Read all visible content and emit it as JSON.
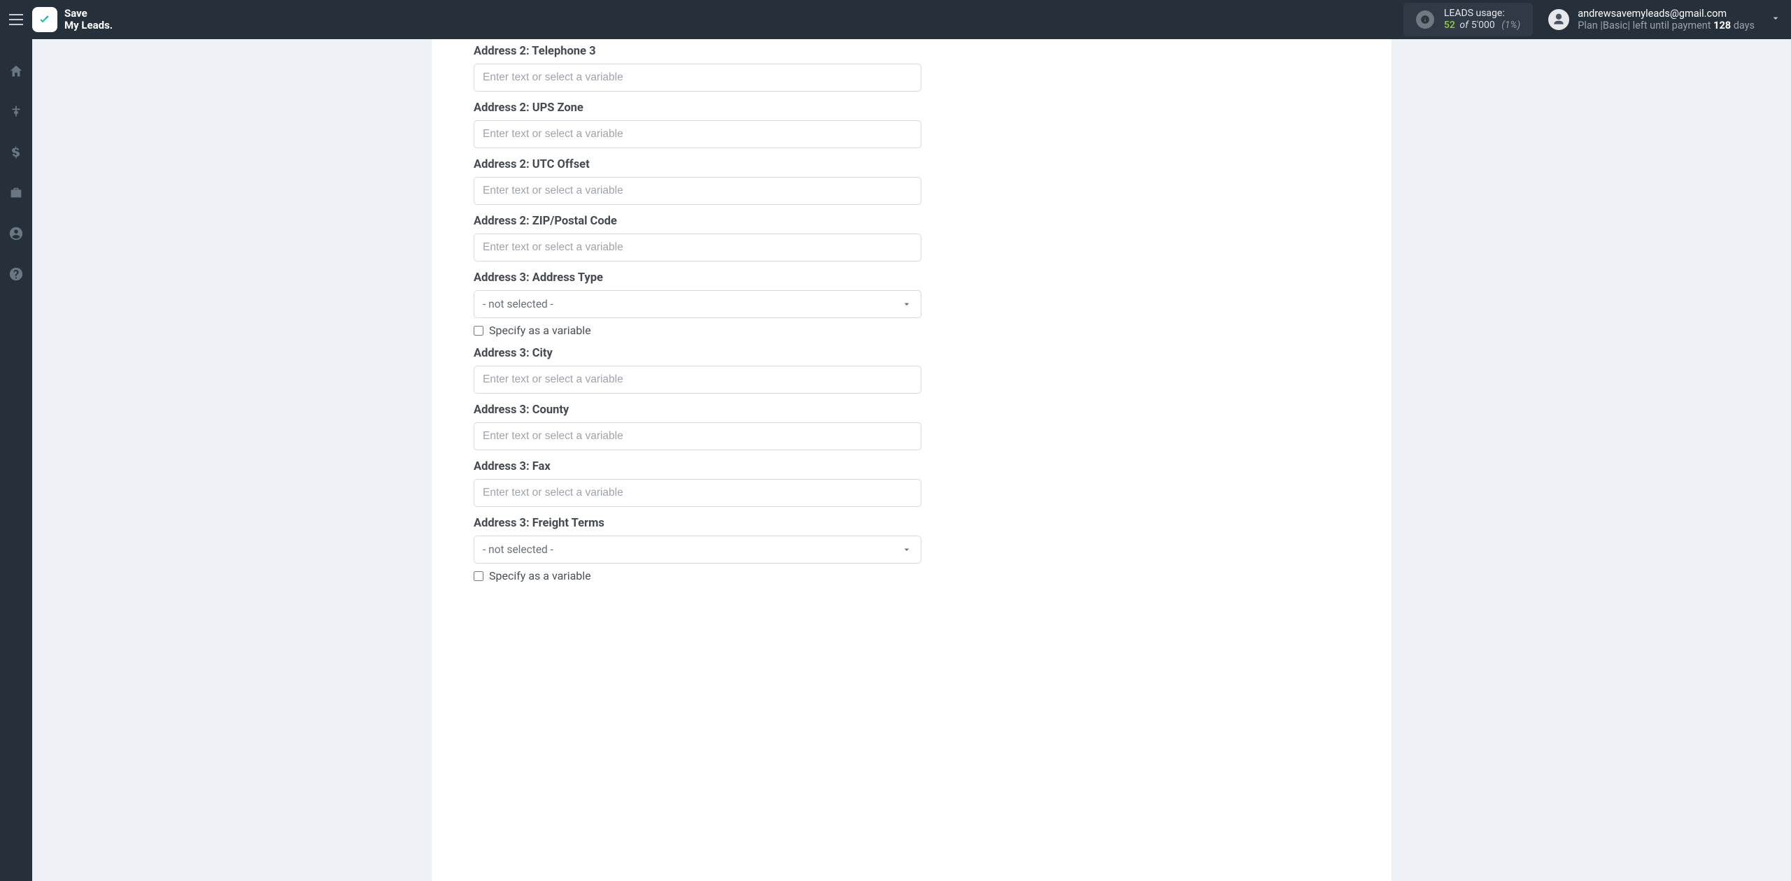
{
  "brand": {
    "line1": "Save",
    "line2": "My Leads."
  },
  "usage": {
    "title": "LEADS usage:",
    "used": "52",
    "of_word": "of",
    "total": "5'000",
    "percent": "(1%)"
  },
  "account": {
    "email": "andrewsavemyleads@gmail.com",
    "plan_prefix": "Plan |",
    "plan_name": "Basic",
    "plan_mid": "| left until payment ",
    "days_count": "128",
    "days_word": " days"
  },
  "form": {
    "placeholder": "Enter text or select a variable",
    "select_default": "- not selected -",
    "specify_label": "Specify as a variable",
    "fields": {
      "addr2_tel3": "Address 2: Telephone 3",
      "addr2_ups": "Address 2: UPS Zone",
      "addr2_utc": "Address 2: UTC Offset",
      "addr2_zip": "Address 2: ZIP/Postal Code",
      "addr3_type": "Address 3: Address Type",
      "addr3_city": "Address 3: City",
      "addr3_county": "Address 3: County",
      "addr3_fax": "Address 3: Fax",
      "addr3_freight": "Address 3: Freight Terms"
    }
  }
}
